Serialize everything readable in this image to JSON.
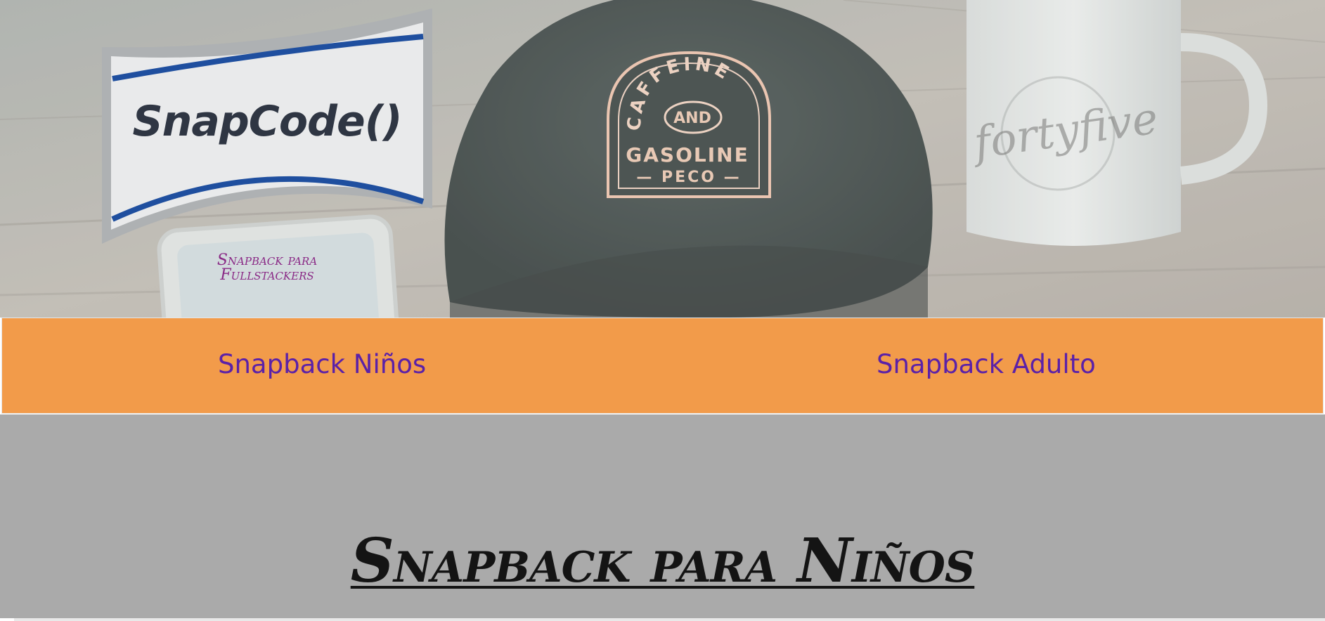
{
  "hero": {
    "logo_text": "SnapCode()",
    "tagline": "Snapback para\nFullstackers",
    "cap_patch": {
      "arc_text": "CAFFEINE",
      "center_text": "AND",
      "main_text": "GASOLINE",
      "bottom_text": "— PECO —"
    },
    "mug_text": "fortyfive"
  },
  "nav": {
    "items": [
      {
        "label": "Snapback Niños"
      },
      {
        "label": "Snapback Adulto"
      }
    ]
  },
  "main": {
    "title": "Snapback para Niños"
  },
  "colors": {
    "nav_background": "#f29b4a",
    "nav_link": "#5b21a8",
    "main_background": "#aaaaaa",
    "title": "#141414",
    "tagline": "#8a2a86",
    "logo_blue": "#1f4f9f",
    "logo_text": "#2f3643"
  }
}
